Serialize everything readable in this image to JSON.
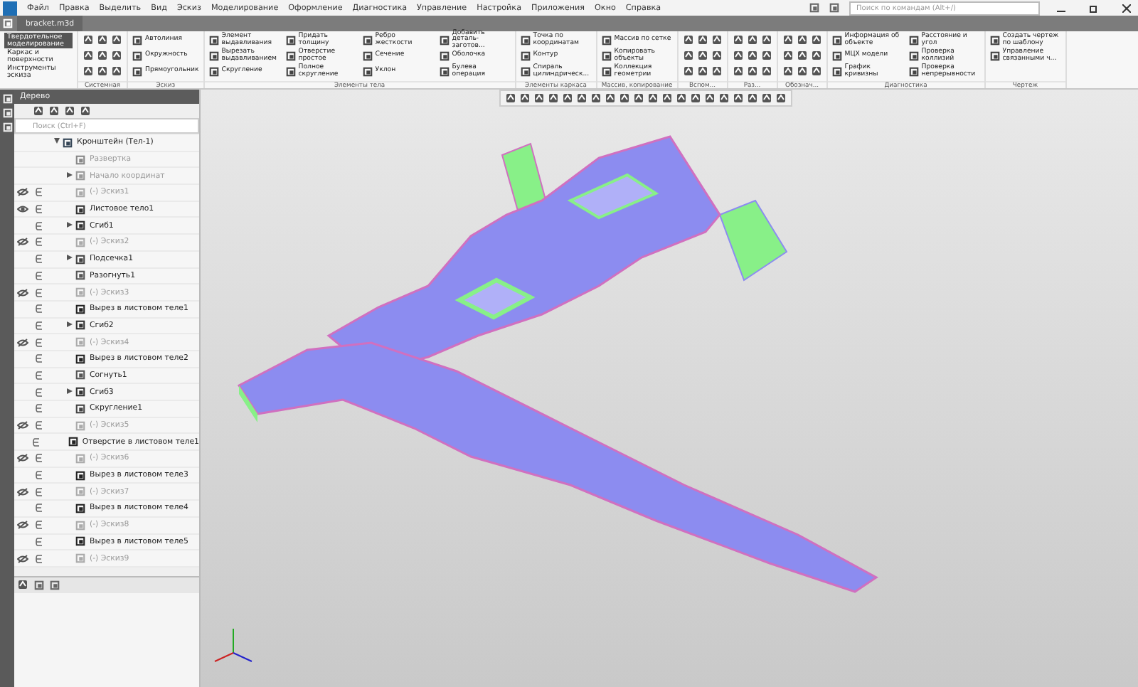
{
  "menu": [
    "Файл",
    "Правка",
    "Выделить",
    "Вид",
    "Эскиз",
    "Моделирование",
    "Оформление",
    "Диагностика",
    "Управление",
    "Настройка",
    "Приложения",
    "Окно",
    "Справка"
  ],
  "search": {
    "placeholder": "Поиск по командам (Alt+/)"
  },
  "document_tab": {
    "title": "bracket.m3d"
  },
  "ribbon": {
    "modes": [
      {
        "label": "Твердотельное моделирование",
        "selected": true
      },
      {
        "label": "Каркас и поверхности",
        "selected": false
      },
      {
        "label": "Инструменты эскиза",
        "selected": false
      }
    ],
    "groups": [
      {
        "label": "Системная",
        "kind": "icons"
      },
      {
        "label": "Эскиз",
        "kind": "commands",
        "commands": [
          "Автолиния",
          "Окружность",
          "Прямоугольник"
        ]
      },
      {
        "label": "Элементы тела",
        "kind": "commands",
        "commands": [
          "Элемент выдавливания",
          "Вырезать выдавливанием",
          "Скругление",
          "Придать толщину",
          "Отверстие простое",
          "Полное скругление",
          "Ребро жесткости",
          "Сечение",
          "Уклон",
          "Добавить деталь-заготов...",
          "Оболочка",
          "Булева операция"
        ]
      },
      {
        "label": "Элементы каркаса",
        "kind": "commands",
        "commands": [
          "Точка по координатам",
          "Контур",
          "Спираль цилиндрическ..."
        ]
      },
      {
        "label": "Массив, копирование",
        "kind": "commands",
        "commands": [
          "Массив по сетке",
          "Копировать объекты",
          "Коллекция геометрии"
        ]
      },
      {
        "label": "Вспом...",
        "kind": "icons"
      },
      {
        "label": "Раз...",
        "kind": "icons"
      },
      {
        "label": "Обознач...",
        "kind": "icons"
      },
      {
        "label": "Диагностика",
        "kind": "commands",
        "commands": [
          "Информация об объекте",
          "МЦХ модели",
          "График кривизны",
          "Расстояние и угол",
          "Проверка коллизий",
          "Проверка непрерывности"
        ]
      },
      {
        "label": "Чертеж",
        "kind": "commands",
        "commands": [
          "Создать чертеж по шаблону",
          "Управление связанными ч..."
        ]
      }
    ]
  },
  "tree_panel": {
    "title": "Дерево",
    "search_placeholder": "Поиск (Ctrl+F)",
    "root": {
      "label": "Кронштейн (Тел-1)",
      "kind": "part",
      "expanded": true,
      "dimmed": false,
      "children": [
        {
          "label": "Развертка",
          "kind": "flat",
          "dimmed": true,
          "included": false
        },
        {
          "label": "Начало координат",
          "kind": "origin",
          "dimmed": true,
          "included": false,
          "expanded": false
        },
        {
          "label": "(-) Эскиз1",
          "kind": "sketch",
          "dimmed": true,
          "included": true,
          "visible": false
        },
        {
          "label": "Листовое тело1",
          "kind": "sheet",
          "dimmed": false,
          "included": true,
          "visible": true
        },
        {
          "label": "Сгиб1",
          "kind": "bend",
          "dimmed": false,
          "included": true,
          "expanded": false
        },
        {
          "label": "(-) Эскиз2",
          "kind": "sketch",
          "dimmed": true,
          "included": true,
          "visible": false
        },
        {
          "label": "Подсечка1",
          "kind": "joggle",
          "dimmed": false,
          "included": true,
          "expanded": false
        },
        {
          "label": "Разогнуть1",
          "kind": "unbend",
          "dimmed": false,
          "included": true
        },
        {
          "label": "(-) Эскиз3",
          "kind": "sketch",
          "dimmed": true,
          "included": true,
          "visible": false
        },
        {
          "label": "Вырез в листовом теле1",
          "kind": "cut",
          "dimmed": false,
          "included": true
        },
        {
          "label": "Сгиб2",
          "kind": "bend",
          "dimmed": false,
          "included": true,
          "expanded": false
        },
        {
          "label": "(-) Эскиз4",
          "kind": "sketch",
          "dimmed": true,
          "included": true,
          "visible": false
        },
        {
          "label": "Вырез в листовом теле2",
          "kind": "cut",
          "dimmed": false,
          "included": true
        },
        {
          "label": "Согнуть1",
          "kind": "unbend",
          "dimmed": false,
          "included": true
        },
        {
          "label": "Сгиб3",
          "kind": "bend",
          "dimmed": false,
          "included": true,
          "expanded": false
        },
        {
          "label": "Скругление1",
          "kind": "fillet",
          "dimmed": false,
          "included": true
        },
        {
          "label": "(-) Эскиз5",
          "kind": "sketch",
          "dimmed": true,
          "included": true,
          "visible": false
        },
        {
          "label": "Отверстие в листовом теле1",
          "kind": "cut",
          "dimmed": false,
          "included": true
        },
        {
          "label": "(-) Эскиз6",
          "kind": "sketch",
          "dimmed": true,
          "included": true,
          "visible": false
        },
        {
          "label": "Вырез в листовом теле3",
          "kind": "cut",
          "dimmed": false,
          "included": true
        },
        {
          "label": "(-) Эскиз7",
          "kind": "sketch",
          "dimmed": true,
          "included": true,
          "visible": false
        },
        {
          "label": "Вырез в листовом теле4",
          "kind": "cut",
          "dimmed": false,
          "included": true
        },
        {
          "label": "(-) Эскиз8",
          "kind": "sketch",
          "dimmed": true,
          "included": true,
          "visible": false
        },
        {
          "label": "Вырез в листовом теле5",
          "kind": "cut",
          "dimmed": false,
          "included": true
        },
        {
          "label": "(-) Эскиз9",
          "kind": "sketch",
          "dimmed": true,
          "included": true,
          "visible": false
        }
      ]
    }
  }
}
